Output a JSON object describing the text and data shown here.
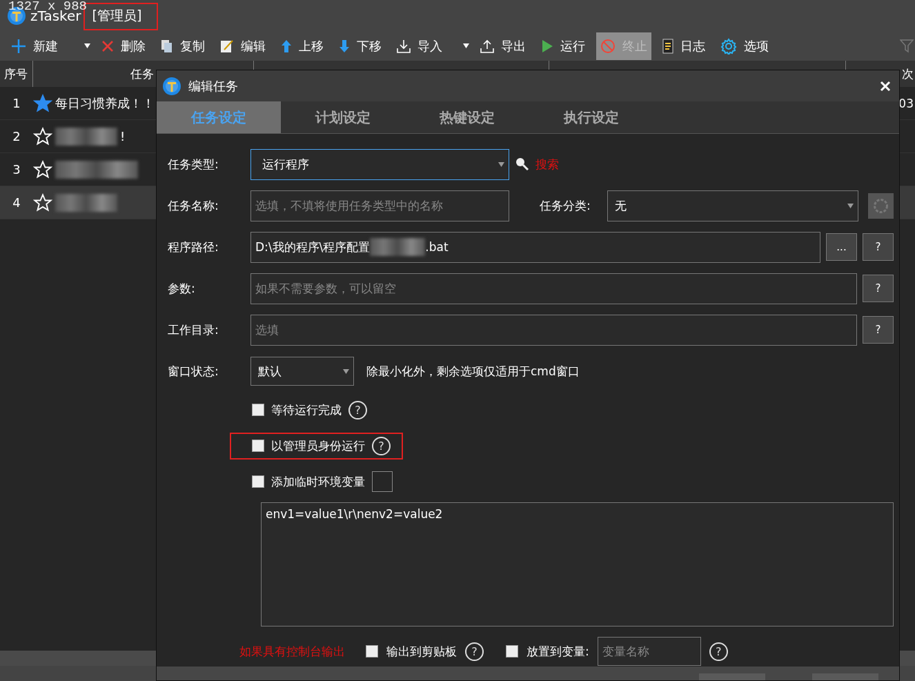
{
  "overlay_text": "1327 x 988",
  "app": {
    "name": "zTasker",
    "role": "[管理员]"
  },
  "toolbar": [
    {
      "kind": "plus",
      "label": "新建",
      "disabled": false,
      "dropdown": true
    },
    {
      "kind": "delete",
      "label": "删除",
      "disabled": false,
      "dropdown": false
    },
    {
      "kind": "copy",
      "label": "复制",
      "disabled": false,
      "dropdown": false
    },
    {
      "kind": "edit",
      "label": "编辑",
      "disabled": false,
      "dropdown": false
    },
    {
      "kind": "up",
      "label": "上移",
      "disabled": false,
      "dropdown": false
    },
    {
      "kind": "down",
      "label": "下移",
      "disabled": false,
      "dropdown": false
    },
    {
      "kind": "import",
      "label": "导入",
      "disabled": false,
      "dropdown": true
    },
    {
      "kind": "export",
      "label": "导出",
      "disabled": false,
      "dropdown": false
    },
    {
      "kind": "run",
      "label": "运行",
      "disabled": false,
      "dropdown": false
    },
    {
      "kind": "stop",
      "label": "终止",
      "disabled": true,
      "dropdown": false
    },
    {
      "kind": "log",
      "label": "日志",
      "disabled": false,
      "dropdown": false
    },
    {
      "kind": "options",
      "label": "选项",
      "disabled": false,
      "dropdown": false
    }
  ],
  "table": {
    "columns": [
      "序号",
      "任务"
    ],
    "last_column": "次",
    "rows": [
      {
        "index": "1",
        "starred": true,
        "name": "每日习惯养成！！",
        "blurred": false,
        "selected": false
      },
      {
        "index": "2",
        "starred": false,
        "name": "!",
        "blurred": true,
        "selected": false
      },
      {
        "index": "3",
        "starred": false,
        "name": "",
        "blurred": true,
        "selected": false
      },
      {
        "index": "4",
        "starred": false,
        "name": "",
        "blurred": true,
        "selected": true
      }
    ],
    "last_column_cell": "03"
  },
  "dialog": {
    "title": "编辑任务",
    "tabs": [
      {
        "label": "任务设定",
        "selected": true
      },
      {
        "label": "计划设定",
        "selected": false
      },
      {
        "label": "热键设定",
        "selected": false
      },
      {
        "label": "执行设定",
        "selected": false
      }
    ],
    "task_type": {
      "label": "任务类型:",
      "value": "运行程序",
      "search_link": "搜索"
    },
    "task_name": {
      "label": "任务名称:",
      "placeholder": "选填，不填将使用任务类型中的名称"
    },
    "category": {
      "label": "任务分类:",
      "value": "无"
    },
    "program_path": {
      "label": "程序路径:",
      "value_start": "D:\\我的程序\\程序配置",
      "value_end": ".bat",
      "browse": "...",
      "help": "?"
    },
    "arguments": {
      "label": "参数:",
      "placeholder": "如果不需要参数，可以留空",
      "help": "?"
    },
    "work_dir": {
      "label": "工作目录:",
      "placeholder": "选填",
      "help": "?"
    },
    "window_state": {
      "label": "窗口状态:",
      "value": "默认",
      "note": "除最小化外，剩余选项仅适用于cmd窗口"
    },
    "checks": [
      {
        "label": "等待运行完成",
        "checked": false,
        "highlighted": false,
        "swatch": false,
        "help": "?"
      },
      {
        "label": "以管理员身份运行",
        "checked": false,
        "highlighted": true,
        "swatch": false,
        "help": "?"
      },
      {
        "label": "添加临时环境变量",
        "checked": false,
        "highlighted": false,
        "swatch": true
      }
    ],
    "env_text": "env1=value1\\r\\nenv2=value2",
    "console_note": "如果具有控制台输出",
    "clipboard": {
      "label": "输出到剪贴板",
      "checked": false,
      "help": "?"
    },
    "variable": {
      "label": "放置到变量:",
      "checked": false,
      "placeholder": "变量名称",
      "help": "?"
    }
  }
}
